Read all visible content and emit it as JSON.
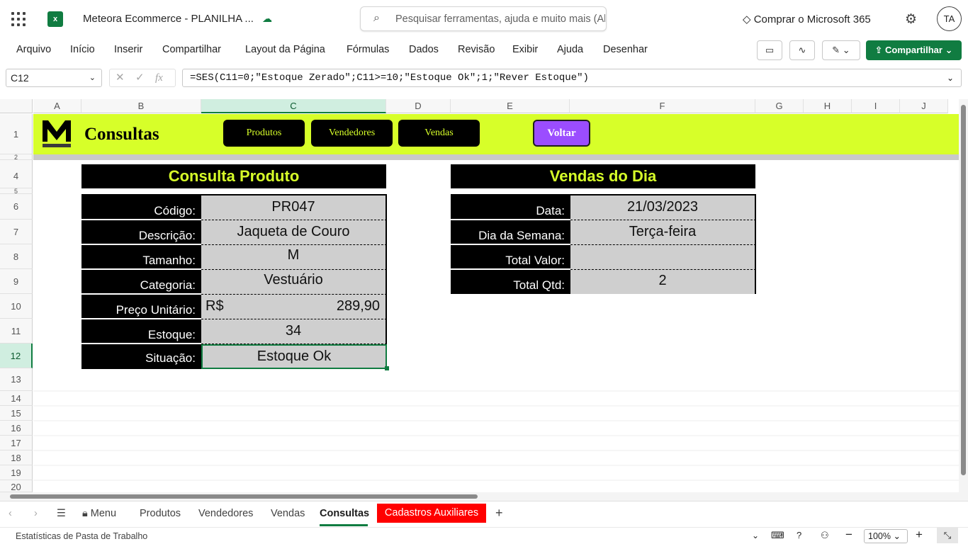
{
  "titlebar": {
    "app_icon": "excel-icon",
    "doc_title": "Meteora Ecommerce - PLANILHA ...",
    "search_placeholder": "Pesquisar ferramentas, ajuda e muito mais (Alt + Q)",
    "buy_label": "Comprar o Microsoft 365",
    "avatar_initials": "TA"
  },
  "menu": {
    "items": [
      "Arquivo",
      "Início",
      "Inserir",
      "Compartilhar",
      "Layout da Página",
      "Fórmulas",
      "Dados",
      "Revisão",
      "Exibir",
      "Ajuda",
      "Desenhar"
    ],
    "share_label": "Compartilhar"
  },
  "formula_bar": {
    "name_box": "C12",
    "fx": "fx",
    "formula": "=SES(C11=0;\"Estoque Zerado\";C11>=10;\"Estoque Ok\";1;\"Rever Estoque\")"
  },
  "columns": [
    "A",
    "B",
    "C",
    "D",
    "E",
    "F",
    "G",
    "H",
    "I",
    "J"
  ],
  "rows": [
    "1",
    "2",
    "4",
    "5",
    "6",
    "7",
    "8",
    "9",
    "10",
    "11",
    "12",
    "13",
    "14",
    "15",
    "16",
    "17",
    "18",
    "19",
    "20"
  ],
  "selected_cell": {
    "column": "C",
    "row": "12"
  },
  "banner": {
    "title": "Consultas",
    "logo_letter": "M",
    "buttons": [
      "Produtos",
      "Vendedores",
      "Vendas"
    ],
    "back_button": "Voltar",
    "accent_color": "#d7ff29",
    "back_color": "#9b4dff"
  },
  "consulta_produto": {
    "title": "Consulta Produto",
    "fields": [
      {
        "label": "Código:",
        "value": "PR047"
      },
      {
        "label": "Descrição:",
        "value": "Jaqueta de Couro"
      },
      {
        "label": "Tamanho:",
        "value": "M"
      },
      {
        "label": "Categoria:",
        "value": "Vestuário"
      },
      {
        "label": "Preço Unitário:",
        "currency": "R$",
        "value": "289,90"
      },
      {
        "label": "Estoque:",
        "value": "34"
      },
      {
        "label": "Situação:",
        "value": "Estoque Ok"
      }
    ]
  },
  "vendas_do_dia": {
    "title": "Vendas do Dia",
    "fields": [
      {
        "label": "Data:",
        "value": "21/03/2023"
      },
      {
        "label": "Dia da Semana:",
        "value": "Terça-feira"
      },
      {
        "label": "Total Valor:",
        "value": ""
      },
      {
        "label": "Total Qtd:",
        "value": "2"
      }
    ]
  },
  "sheet_tabs": {
    "menu_label": "Menu",
    "tabs": [
      "Produtos",
      "Vendedores",
      "Vendas",
      "Consultas"
    ],
    "active": "Consultas",
    "red_tab": "Cadastros Auxiliares"
  },
  "status_bar": {
    "workbook_stats": "Estatísticas de Pasta de Trabalho",
    "zoom": "100%"
  }
}
